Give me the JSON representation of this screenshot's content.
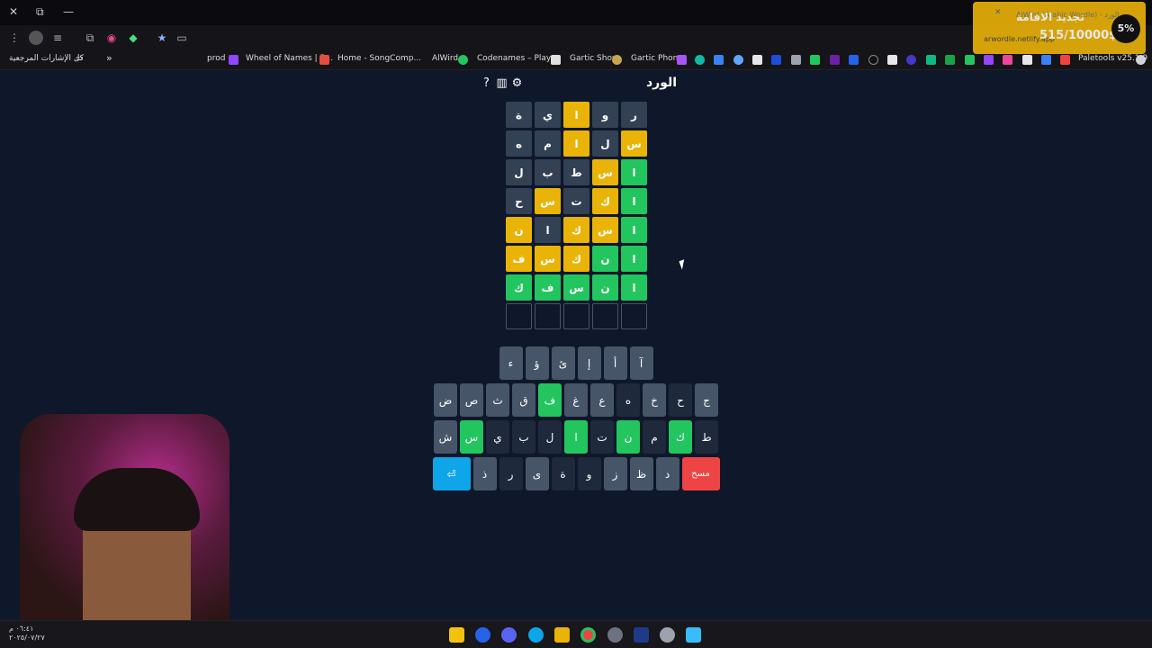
{
  "browser": {
    "window_controls": [
      "✕",
      "⧉",
      "—"
    ],
    "bookmarks_label": "كل الإشارات المرجعية",
    "bookmarks": [
      "prod",
      "Wheel of Names | R...",
      "Home - SongComp...",
      "AlWird",
      "Codenames – Play...",
      "Gartic Show",
      "Gartic Phone",
      "Paletools v25.1.9"
    ],
    "chevron": "»"
  },
  "game": {
    "title": "الورد",
    "icons": [
      "help-icon",
      "stats-icon",
      "settings-icon"
    ],
    "board": [
      [
        {
          "l": "ر",
          "s": "absent"
        },
        {
          "l": "و",
          "s": "absent"
        },
        {
          "l": "ا",
          "s": "present"
        },
        {
          "l": "ي",
          "s": "absent"
        },
        {
          "l": "ة",
          "s": "absent"
        }
      ],
      [
        {
          "l": "س",
          "s": "present"
        },
        {
          "l": "ل",
          "s": "absent"
        },
        {
          "l": "ا",
          "s": "present"
        },
        {
          "l": "م",
          "s": "absent"
        },
        {
          "l": "ه",
          "s": "absent"
        }
      ],
      [
        {
          "l": "ا",
          "s": "correct"
        },
        {
          "l": "س",
          "s": "present"
        },
        {
          "l": "ط",
          "s": "absent"
        },
        {
          "l": "ب",
          "s": "absent"
        },
        {
          "l": "ل",
          "s": "absent"
        }
      ],
      [
        {
          "l": "ا",
          "s": "correct"
        },
        {
          "l": "ك",
          "s": "present"
        },
        {
          "l": "ت",
          "s": "absent"
        },
        {
          "l": "س",
          "s": "present"
        },
        {
          "l": "ح",
          "s": "absent"
        }
      ],
      [
        {
          "l": "ا",
          "s": "correct"
        },
        {
          "l": "س",
          "s": "present"
        },
        {
          "l": "ك",
          "s": "present"
        },
        {
          "l": "ا",
          "s": "absent"
        },
        {
          "l": "ن",
          "s": "present"
        }
      ],
      [
        {
          "l": "ا",
          "s": "correct"
        },
        {
          "l": "ن",
          "s": "correct"
        },
        {
          "l": "ك",
          "s": "present"
        },
        {
          "l": "س",
          "s": "present"
        },
        {
          "l": "ف",
          "s": "present"
        }
      ],
      [
        {
          "l": "ا",
          "s": "correct"
        },
        {
          "l": "ن",
          "s": "correct"
        },
        {
          "l": "س",
          "s": "correct"
        },
        {
          "l": "ف",
          "s": "correct"
        },
        {
          "l": "ك",
          "s": "correct"
        }
      ],
      [
        {
          "l": "",
          "s": "empty"
        },
        {
          "l": "",
          "s": "empty"
        },
        {
          "l": "",
          "s": "empty"
        },
        {
          "l": "",
          "s": "empty"
        },
        {
          "l": "",
          "s": "empty"
        }
      ]
    ],
    "keyboard": [
      [
        {
          "k": "آ"
        },
        {
          "k": "أ"
        },
        {
          "k": "إ"
        },
        {
          "k": "ئ"
        },
        {
          "k": "ؤ"
        },
        {
          "k": "ء"
        }
      ],
      [
        {
          "k": "ج"
        },
        {
          "k": "ح",
          "s": "dark"
        },
        {
          "k": "خ"
        },
        {
          "k": "ه",
          "s": "dark"
        },
        {
          "k": "ع"
        },
        {
          "k": "غ"
        },
        {
          "k": "ف",
          "s": "correct"
        },
        {
          "k": "ق"
        },
        {
          "k": "ث"
        },
        {
          "k": "ص"
        },
        {
          "k": "ض"
        }
      ],
      [
        {
          "k": "ط",
          "s": "dark"
        },
        {
          "k": "ك",
          "s": "correct"
        },
        {
          "k": "م",
          "s": "dark"
        },
        {
          "k": "ن",
          "s": "correct"
        },
        {
          "k": "ت",
          "s": "dark"
        },
        {
          "k": "ا",
          "s": "correct"
        },
        {
          "k": "ل",
          "s": "dark"
        },
        {
          "k": "ب",
          "s": "dark"
        },
        {
          "k": "ي",
          "s": "dark"
        },
        {
          "k": "س",
          "s": "correct"
        },
        {
          "k": "ش"
        }
      ],
      [
        {
          "k": "مسح",
          "s": "enter"
        },
        {
          "k": "د"
        },
        {
          "k": "ظ"
        },
        {
          "k": "ز"
        },
        {
          "k": "و",
          "s": "dark"
        },
        {
          "k": "ة",
          "s": "dark"
        },
        {
          "k": "ى"
        },
        {
          "k": "ر",
          "s": "dark"
        },
        {
          "k": "ذ"
        },
        {
          "k": "⏎",
          "s": "back"
        }
      ]
    ]
  },
  "popup": {
    "title": "تجديد الاقامة",
    "amount": "515/10000$",
    "percent": "5%",
    "tab_text": "AlWird (Arabic Wordle) - الورد",
    "url": "arwordle.netlify.app",
    "progress": 0.05
  },
  "clock": {
    "time": "٠٦:٤١ م",
    "date": "٢٠٢٥/٠٧/٢٧"
  }
}
